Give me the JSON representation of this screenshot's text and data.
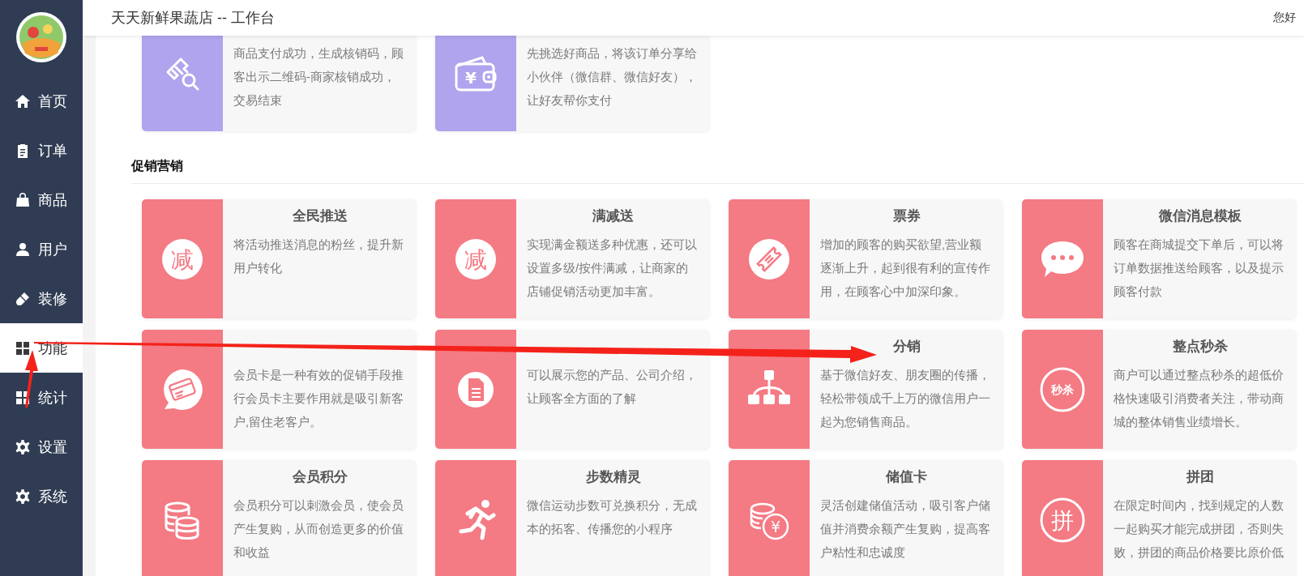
{
  "header": {
    "title": "天天新鲜果蔬店 -- 工作台",
    "greeting": "您好"
  },
  "sidebar": {
    "items": [
      {
        "label": "首页",
        "selected": false
      },
      {
        "label": "订单",
        "selected": false
      },
      {
        "label": "商品",
        "selected": false
      },
      {
        "label": "用户",
        "selected": false
      },
      {
        "label": "装修",
        "selected": false
      },
      {
        "label": "功能",
        "selected": true
      },
      {
        "label": "统计",
        "selected": false
      },
      {
        "label": "设置",
        "selected": false
      },
      {
        "label": "系统",
        "selected": false
      }
    ]
  },
  "sections": [
    {
      "cards": [
        {
          "color": "#b0a4ee",
          "description": "商品支付成功，生成核销码，顾客出示二维码-商家核销成功，交易结束"
        },
        {
          "glyph": "¥",
          "color": "#b0a4ee",
          "description": "先挑选好商品，将该订单分享给小伙伴（微信群、微信好友），让好友帮你支付"
        }
      ]
    },
    {
      "heading": "促销营销",
      "cards": [
        {
          "title": "全民推送",
          "glyph": "减",
          "color": "#f47a84",
          "description": "将活动推送消息的粉丝，提升新用户转化"
        },
        {
          "title": "满减送",
          "glyph": "减",
          "color": "#f47a84",
          "description": "实现满金额送多种优惠，还可以设置多级/按件满减，让商家的店铺促销活动更加丰富。"
        },
        {
          "title": "票券",
          "color": "#f47a84",
          "description": "增加的顾客的购买欲望,营业额逐渐上升，起到很有利的宣传作用，在顾客心中加深印象。"
        },
        {
          "title": "微信消息模板",
          "color": "#f47a84",
          "description": "顾客在商城提交下单后，可以将订单数据推送给顾客，以及提示顾客付款"
        },
        {
          "color": "#f47a84",
          "description": "会员卡是一种有效的促销手段推行会员卡主要作用就是吸引新客户,留住老客户。"
        },
        {
          "color": "#f47a84",
          "description": "可以展示您的产品、公司介绍，让顾客全方面的了解"
        },
        {
          "title": "分销",
          "color": "#f47a84",
          "description": "基于微信好友、朋友圈的传播，轻松带领成千上万的微信用户一起为您销售商品。"
        },
        {
          "title": "整点秒杀",
          "glyph": "秒杀",
          "color": "#f47a84",
          "description": "商户可以通过整点秒杀的超低价格快速吸引消费者关注，带动商城的整体销售业绩增长。"
        },
        {
          "title": "会员积分",
          "color": "#f47a84",
          "description": "会员积分可以刺激会员，使会员产生复购，从而创造更多的价值和收益"
        },
        {
          "title": "步数精灵",
          "color": "#f47a84",
          "description": "微信运动步数可兑换积分，无成本的拓客、传播您的小程序"
        },
        {
          "title": "储值卡",
          "glyph": "¥",
          "color": "#f47a84",
          "description": "灵活创建储值活动，吸引客户储值并消费余额产生复购，提高客户粘性和忠诚度"
        },
        {
          "title": "拼团",
          "glyph": "拼",
          "color": "#f47a84",
          "description": "在限定时间内，找到规定的人数一起购买才能完成拼团，否则失败，拼团的商品价格要比原价低"
        }
      ]
    }
  ]
}
